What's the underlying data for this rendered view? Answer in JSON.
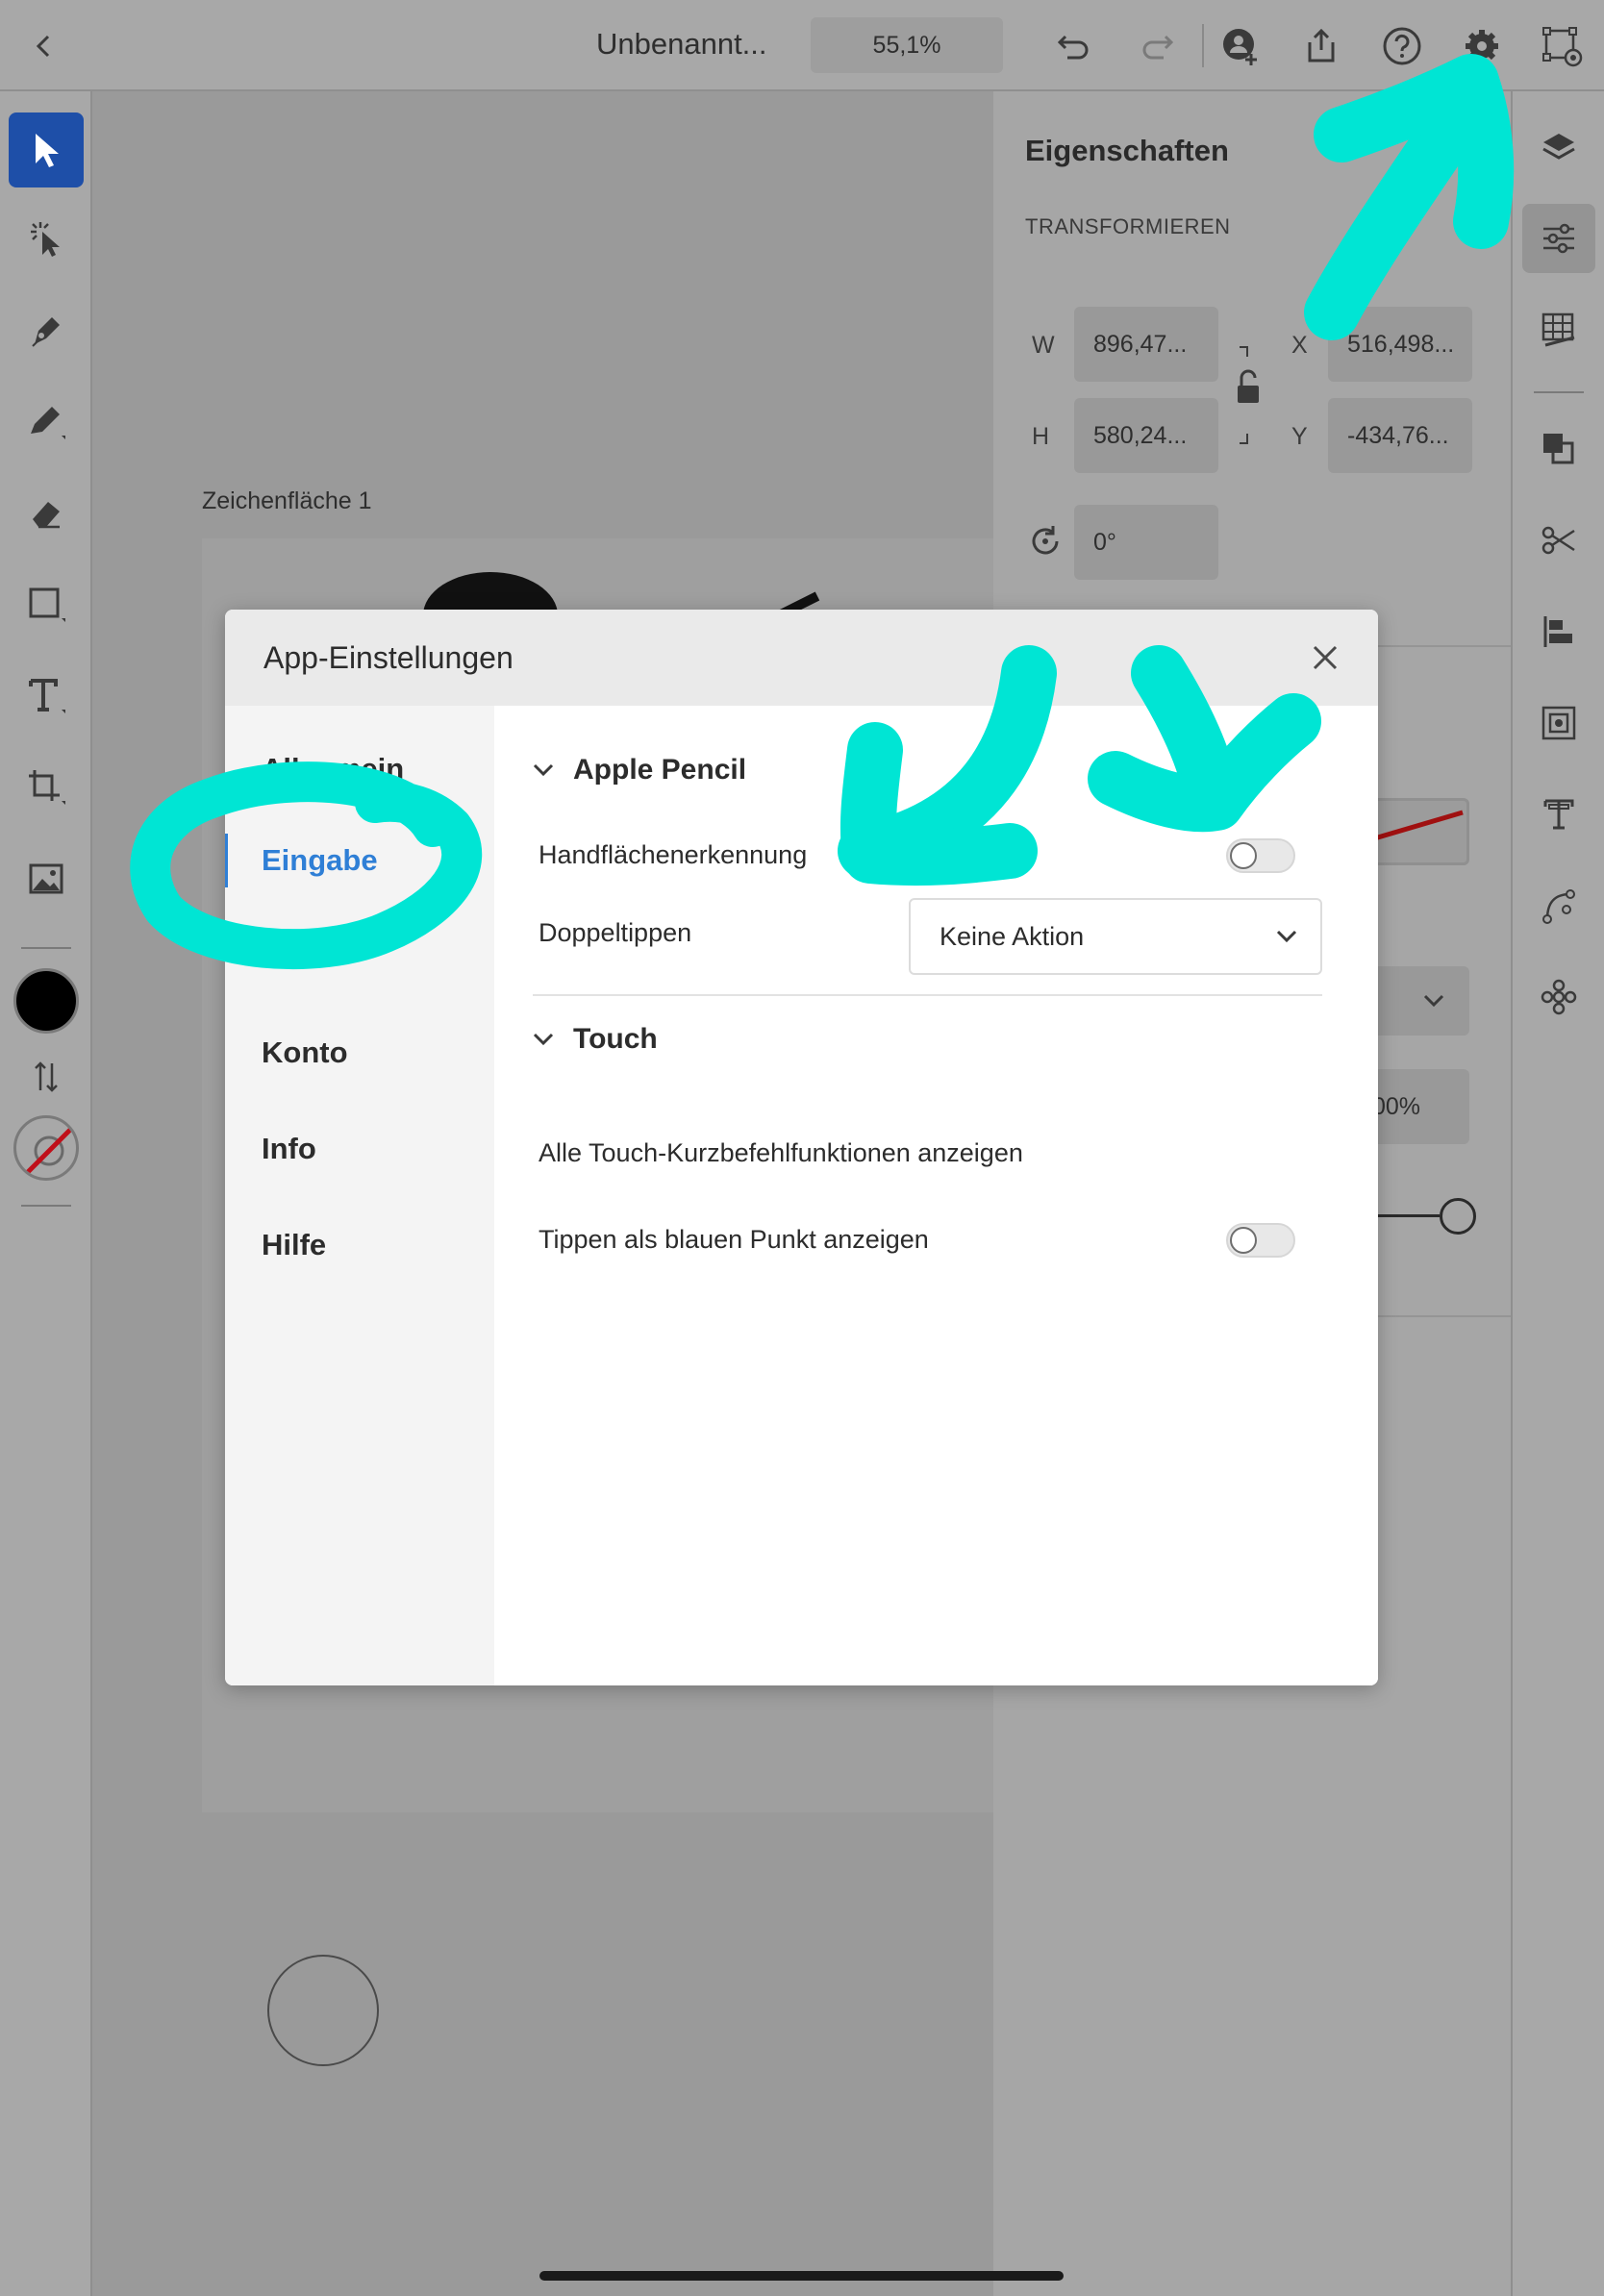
{
  "topbar": {
    "back_icon": "chevron-left-icon",
    "document_title": "Unbenannt...",
    "zoom_level": "55,1%",
    "icons": [
      "undo-icon",
      "redo-icon",
      "invite-user-icon",
      "share-icon",
      "help-icon",
      "gear-icon",
      "preview-icon"
    ]
  },
  "left_toolbar": {
    "tools": [
      "selection-tool-icon",
      "direct-selection-tool-icon",
      "pen-tool-icon",
      "pencil-tool-icon",
      "eraser-tool-icon",
      "rectangle-tool-icon",
      "type-tool-icon",
      "transform-tool-icon",
      "image-tool-icon"
    ],
    "active_tool": "selection-tool-icon",
    "fill_color": "#000000"
  },
  "canvas": {
    "artboard_label": "Zeichenfläche 1"
  },
  "properties": {
    "title": "Eigenschaften",
    "section": "TRANSFORMIEREN",
    "w_label": "W",
    "w_value": "896,47...",
    "h_label": "H",
    "h_value": "580,24...",
    "x_label": "X",
    "x_value": "516,498...",
    "y_label": "Y",
    "y_value": "-434,76...",
    "rotation_value": "0°",
    "partial_opacity_value": "00%"
  },
  "right_toolbar": {
    "tools": [
      "layers-icon",
      "properties-icon",
      "grid-icon",
      "pathfinder-icon",
      "scissors-icon",
      "align-icon",
      "repeat-grid-icon",
      "text-panel-icon",
      "path-icon",
      "symbols-icon"
    ],
    "active_tool": "properties-icon"
  },
  "modal": {
    "title": "App-Einstellungen",
    "nav": {
      "allgemein": "Allgemein",
      "eingabe": "Eingabe",
      "konto": "Konto",
      "info": "Info",
      "hilfe": "Hilfe"
    },
    "selected_nav": "Eingabe",
    "apple_pencil": {
      "header": "Apple Pencil",
      "palm_rejection_label": "Handflächenerkennung",
      "palm_rejection_on": false,
      "double_tap_label": "Doppeltippen",
      "double_tap_value": "Keine Aktion"
    },
    "touch": {
      "header": "Touch",
      "shortcuts_label": "Alle Touch-Kurzbefehlfunktionen anzeigen",
      "blue_dot_label": "Tippen als blauen Punkt anzeigen",
      "blue_dot_on": false
    }
  },
  "colors": {
    "accent_blue": "#2f7fd6",
    "annotation_cyan": "#00e5d4",
    "active_tool_blue": "#1e4fa8"
  }
}
